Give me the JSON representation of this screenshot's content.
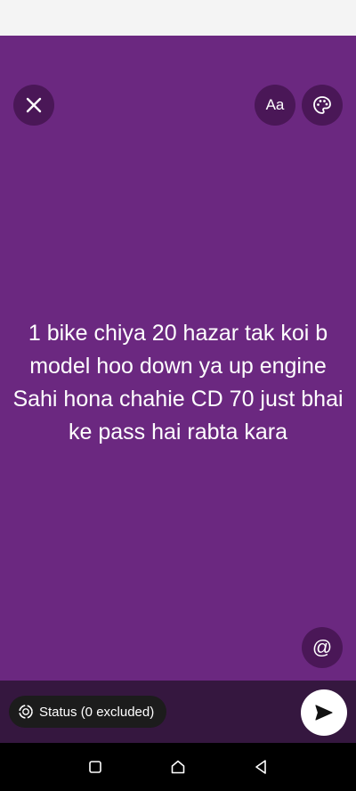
{
  "composer": {
    "status_text": "1 bike chiya 20 hazar tak koi b model hoo down ya up engine Sahi hona chahie CD 70 just bhai ke pass hai rabta kara",
    "font_button_label": "Aa",
    "mention_button_label": "@",
    "background_color": "#6b2880"
  },
  "footer": {
    "audience_label": "Status (0 excluded)"
  },
  "icons": {
    "close": "close-icon",
    "palette": "palette-icon",
    "send": "send-icon",
    "audience": "status-ring-icon"
  }
}
